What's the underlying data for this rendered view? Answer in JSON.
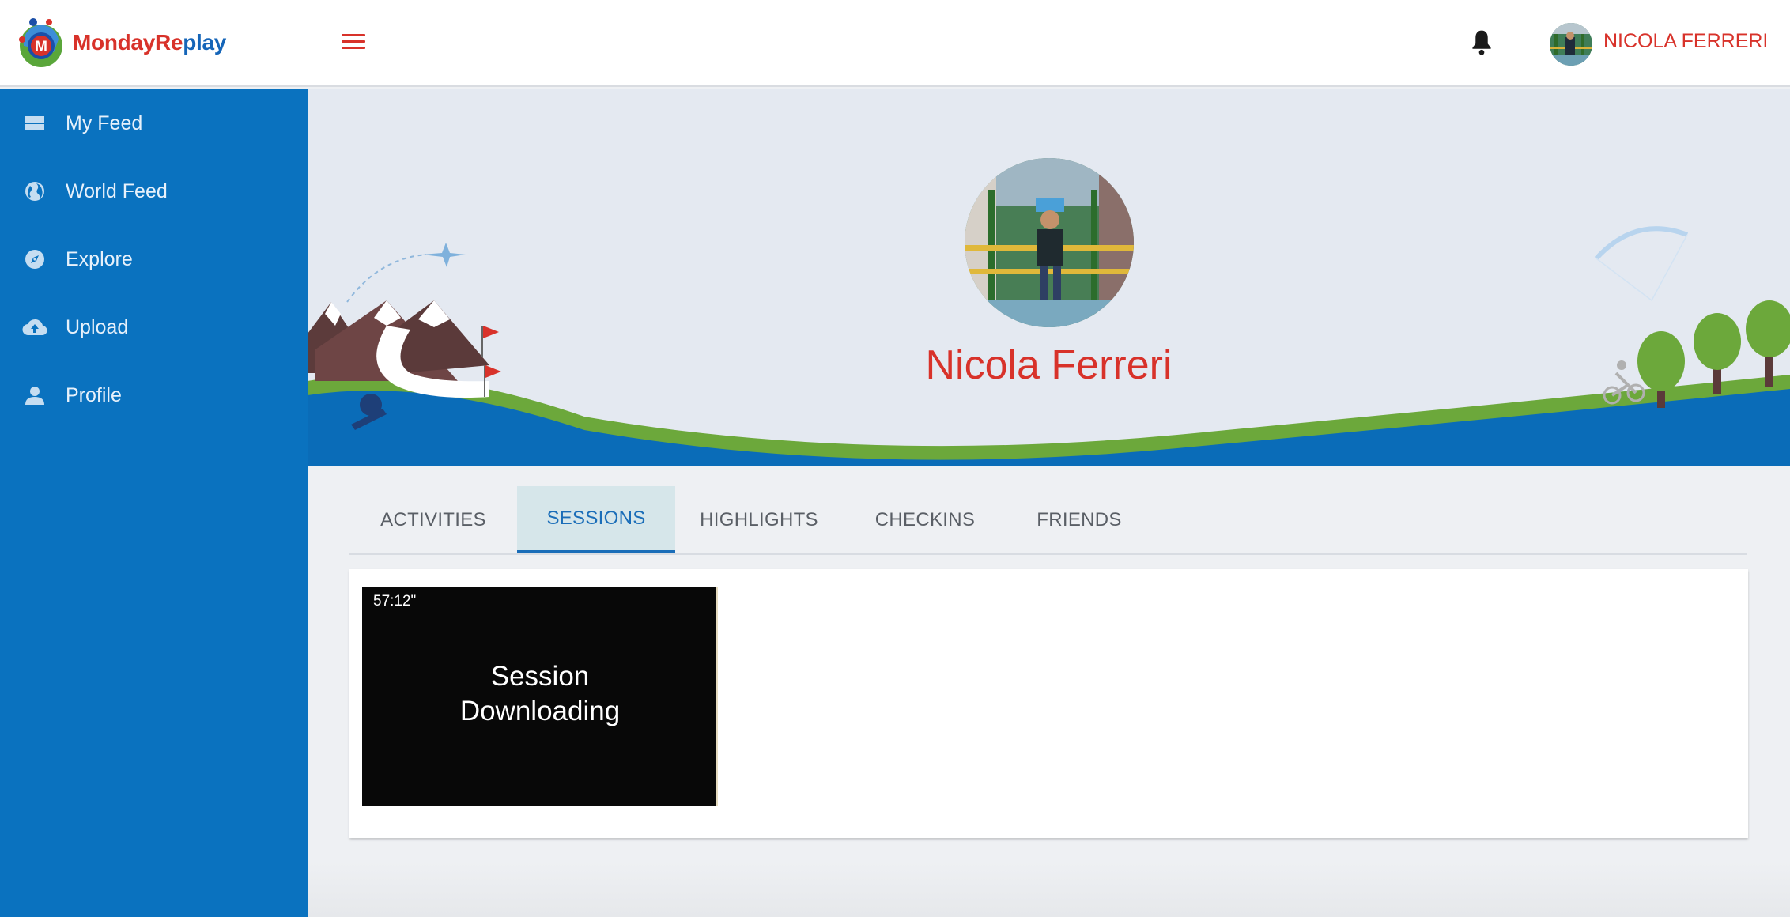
{
  "app": {
    "logo_part1": "MondayRe",
    "logo_part2": "play",
    "logo_badge": "M",
    "brand_red": "#d8322a",
    "brand_blue": "#1565b8"
  },
  "header": {
    "user_name": "NICOLA FERRERI",
    "menu_icon": "hamburger-icon",
    "notification_icon": "bell-icon"
  },
  "sidebar": {
    "items": [
      {
        "label": "My Feed",
        "icon": "feed-icon"
      },
      {
        "label": "World Feed",
        "icon": "globe-icon"
      },
      {
        "label": "Explore",
        "icon": "compass-icon"
      },
      {
        "label": "Upload",
        "icon": "cloud-upload-icon"
      },
      {
        "label": "Profile",
        "icon": "person-icon"
      }
    ]
  },
  "profile": {
    "name": "Nicola Ferreri"
  },
  "tabs": [
    {
      "label": "ACTIVITIES",
      "active": false
    },
    {
      "label": "SESSIONS",
      "active": true
    },
    {
      "label": "HIGHLIGHTS",
      "active": false
    },
    {
      "label": "CHECKINS",
      "active": false
    },
    {
      "label": "FRIENDS",
      "active": false
    }
  ],
  "sessions": [
    {
      "duration": "57:12\"",
      "status_line1": "Session",
      "status_line2": "Downloading"
    }
  ]
}
